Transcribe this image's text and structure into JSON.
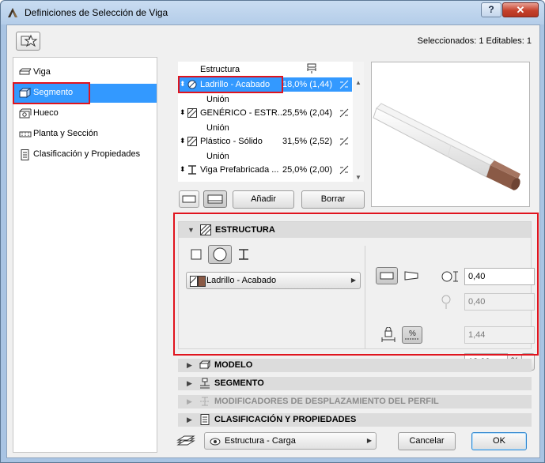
{
  "window": {
    "title": "Definiciones de Selección de Viga",
    "help_label": "?",
    "close_label": "✕"
  },
  "header": {
    "selection_info": "Seleccionados: 1 Editables: 1"
  },
  "nav": {
    "items": [
      {
        "label": "Viga",
        "icon": "beam-icon"
      },
      {
        "label": "Segmento",
        "icon": "segment-icon"
      },
      {
        "label": "Hueco",
        "icon": "hole-icon"
      },
      {
        "label": "Planta y Sección",
        "icon": "floor-plan-section-icon"
      },
      {
        "label": "Clasificación y Propiedades",
        "icon": "document-icon"
      }
    ],
    "active_index": 1
  },
  "layers": {
    "header_label": "Estructura",
    "union_label": "Unión",
    "rows": [
      {
        "name": "Ladrillo - Acabado",
        "percent": "18,0% (1,44)",
        "fill": "hatch-circle"
      },
      {
        "name": "GENÉRICO - ESTR...",
        "percent": "25,5% (2,04)",
        "fill": "hatch-diagonal"
      },
      {
        "name": "Plástico - Sólido",
        "percent": "31,5% (2,52)",
        "fill": "hatch-diagonal"
      },
      {
        "name": "Viga Prefabricada ...",
        "percent": "25,0% (2,00)",
        "fill": "i-profile"
      }
    ]
  },
  "layer_buttons": {
    "add_label": "Añadir",
    "delete_label": "Borrar"
  },
  "structure_panel": {
    "title": "ESTRUCTURA",
    "material_value": "Ladrillo - Acabado",
    "width_value": "0,40",
    "height_value": "0,40",
    "length_value": "1,44",
    "percent_value": "18,00",
    "percent_unit": "%"
  },
  "sections": [
    {
      "title": "MODELO",
      "enabled": true
    },
    {
      "title": "SEGMENTO",
      "enabled": true
    },
    {
      "title": "MODIFICADORES DE DESPLAZAMIENTO DEL PERFIL",
      "enabled": false
    },
    {
      "title": "CLASIFICACIÓN Y PROPIEDADES",
      "enabled": true
    }
  ],
  "footer": {
    "layer_combo_value": "Estructura - Carga",
    "cancel_label": "Cancelar",
    "ok_label": "OK"
  },
  "colors": {
    "selection": "#3399ff",
    "highlight_frame": "#e0141e",
    "brick": "#8a5a46"
  }
}
